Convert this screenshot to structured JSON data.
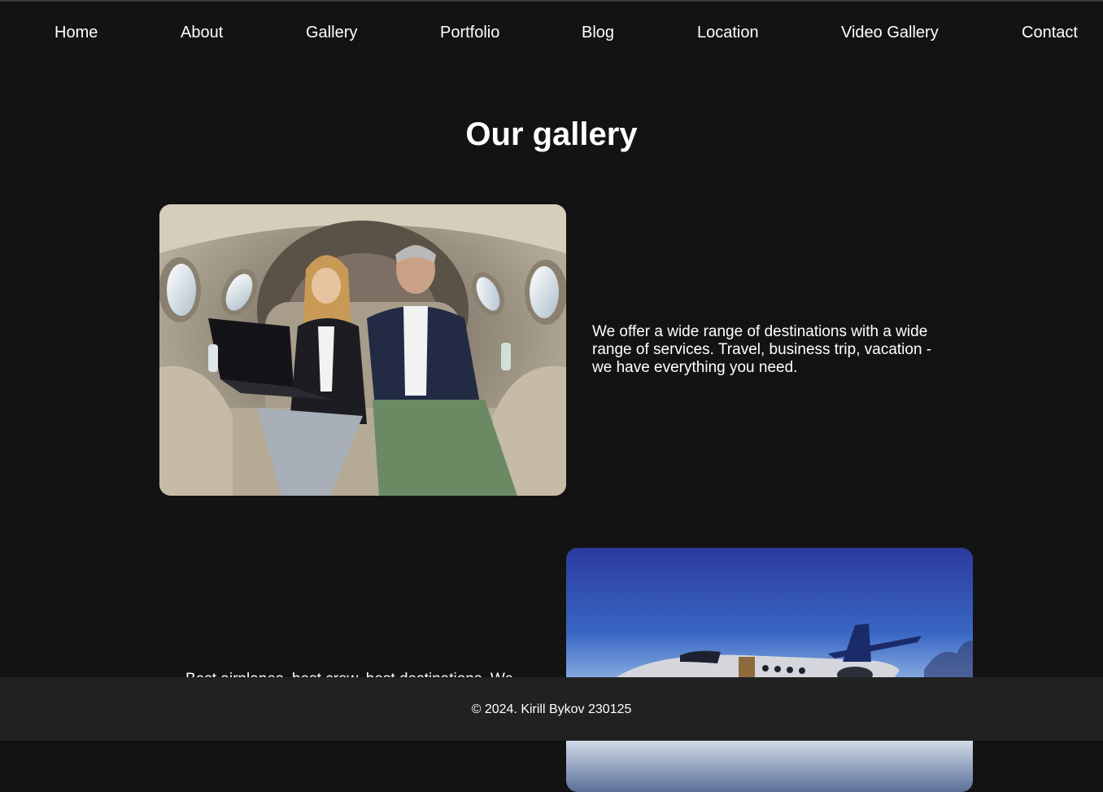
{
  "nav": {
    "items": [
      {
        "label": "Home"
      },
      {
        "label": "About"
      },
      {
        "label": "Gallery"
      },
      {
        "label": "Portfolio"
      },
      {
        "label": "Blog"
      },
      {
        "label": "Location"
      },
      {
        "label": "Video Gallery"
      },
      {
        "label": "Contact"
      }
    ]
  },
  "page": {
    "title": "Our gallery"
  },
  "gallery": {
    "items": [
      {
        "image": "jet-cabin-business-people-photo",
        "text": "We offer a wide range of destinations with a wide range of services. Travel, business trip, vacation - we have everything you need."
      },
      {
        "image": "private-jet-in-flight-photo",
        "text": "Best airplanes, best crew, best destinations. We"
      }
    ]
  },
  "footer": {
    "copyright": "© 2024. Kirill Bykov 230125"
  },
  "colors": {
    "background": "#131313",
    "footer": "#212121",
    "text": "#ffffff"
  }
}
